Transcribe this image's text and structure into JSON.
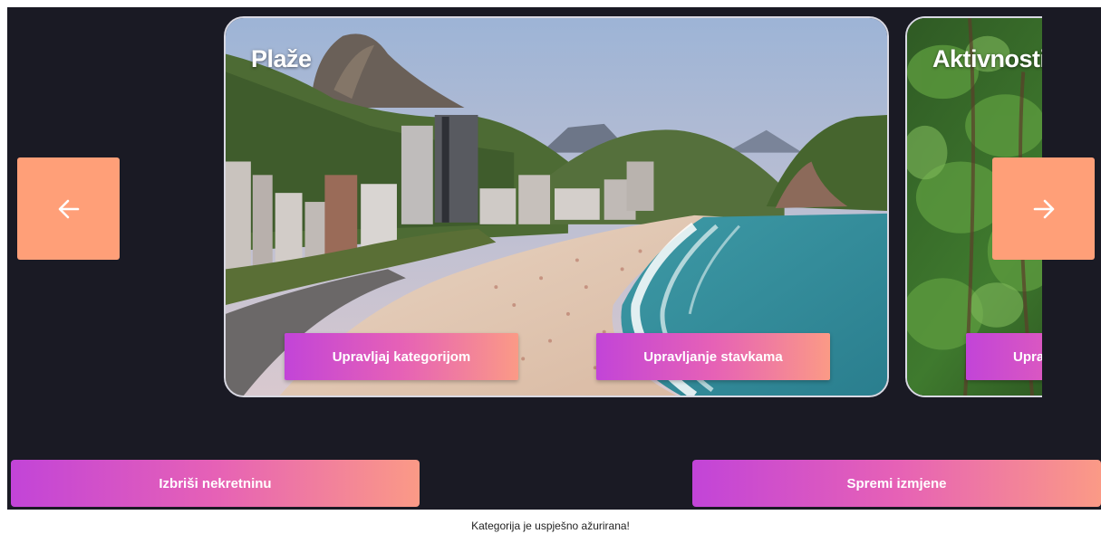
{
  "carousel": {
    "prev_icon": "arrow-left-icon",
    "next_icon": "arrow-right-icon",
    "nav_color": "#ff9f78",
    "cards": [
      {
        "title": "Plaže",
        "manage_category_label": "Upravljaj kategorijom",
        "manage_items_label": "Upravljanje stavkama"
      },
      {
        "title": "Aktivnosti",
        "manage_category_label": "Upravljaj kategorijom"
      }
    ]
  },
  "actions": {
    "delete_label": "Izbriši nekretninu",
    "save_label": "Spremi izmjene"
  },
  "status": {
    "message": "Kategorija je uspješno ažurirana!"
  },
  "colors": {
    "background": "#1a1a24",
    "gradient_start": "#c244d8",
    "gradient_end": "#fb9a86"
  }
}
